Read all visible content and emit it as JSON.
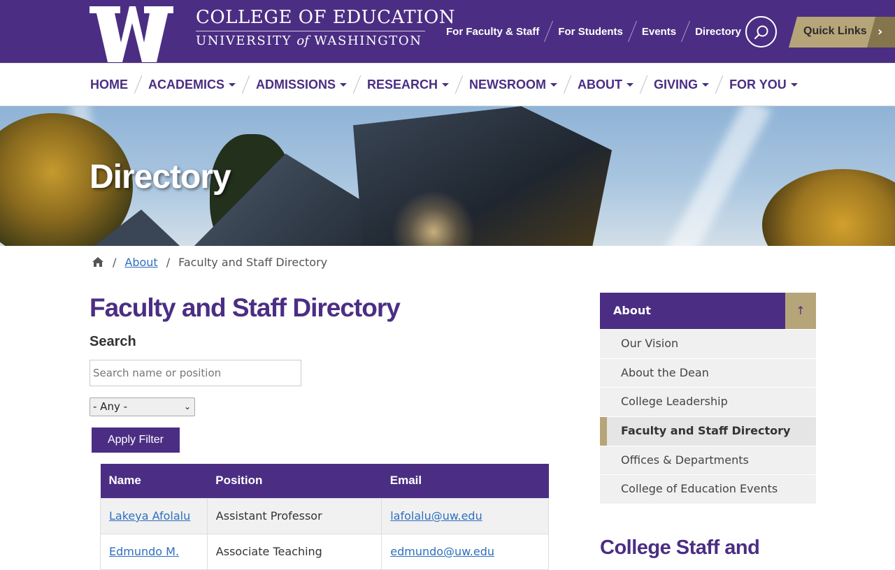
{
  "header": {
    "college_line1": "COLLEGE OF EDUCATION",
    "college_line2_a": "UNIVERSITY",
    "college_line2_of": "of",
    "college_line2_b": "WASHINGTON",
    "utility_links": [
      "For Faculty & Staff",
      "For Students",
      "Events",
      "Directory"
    ],
    "quick_links_label": "Quick Links"
  },
  "main_nav": [
    "HOME",
    "ACADEMICS",
    "ADMISSIONS",
    "RESEARCH",
    "NEWSROOM",
    "ABOUT",
    "GIVING",
    "FOR YOU"
  ],
  "hero": {
    "title": "Directory"
  },
  "breadcrumb": {
    "about": "About",
    "current": "Faculty and Staff Directory"
  },
  "page": {
    "title": "Faculty and Staff Directory",
    "search_label": "Search",
    "search_placeholder": "Search name or position",
    "select_value": "- Any -",
    "apply_label": "Apply Filter"
  },
  "table": {
    "headers": [
      "Name",
      "Position",
      "Email"
    ],
    "rows": [
      {
        "name": "Lakeya Afolalu",
        "position": "Assistant Professor",
        "email": "lafolalu@uw.edu"
      },
      {
        "name": "Edmundo M.",
        "position": "Associate Teaching",
        "email": "edmundo@uw.edu"
      }
    ]
  },
  "sidebar": {
    "title": "About",
    "items": [
      "Our Vision",
      "About the Dean",
      "College Leadership",
      "Faculty and Staff Directory",
      "Offices & Departments",
      "College of Education Events"
    ],
    "bottom_heading": "College Staff and"
  },
  "colors": {
    "purple": "#4b2e83",
    "gold": "#b7a57a",
    "dark_gold": "#85754d",
    "link": "#2f6fbf"
  }
}
